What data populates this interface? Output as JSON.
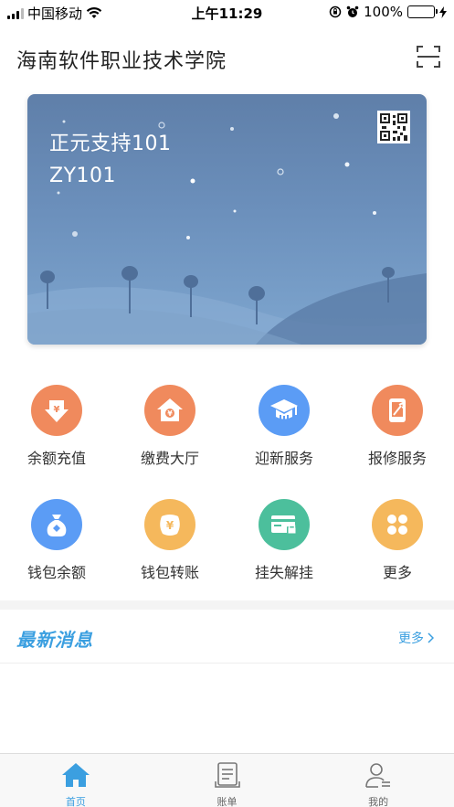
{
  "status_bar": {
    "carrier": "中国移动",
    "time": "上午11:29",
    "battery": "100%"
  },
  "header": {
    "title": "海南软件职业技术学院",
    "scan_icon": "scan-icon"
  },
  "card": {
    "name": "正元支持101",
    "id": "ZY101",
    "qr_icon": "qr-code-icon"
  },
  "services": [
    {
      "label": "余额充值",
      "icon": "recharge-icon",
      "color": "#f08a5d"
    },
    {
      "label": "缴费大厅",
      "icon": "payment-hall-icon",
      "color": "#f08a5d"
    },
    {
      "label": "迎新服务",
      "icon": "graduation-cap-icon",
      "color": "#5b9cf5"
    },
    {
      "label": "报修服务",
      "icon": "repair-icon",
      "color": "#f08a5d"
    },
    {
      "label": "钱包余额",
      "icon": "wallet-balance-icon",
      "color": "#5b9cf5"
    },
    {
      "label": "钱包转账",
      "icon": "wallet-transfer-icon",
      "color": "#f5b85c"
    },
    {
      "label": "挂失解挂",
      "icon": "card-lock-icon",
      "color": "#4cbf9c"
    },
    {
      "label": "更多",
      "icon": "more-icon",
      "color": "#f5b85c"
    }
  ],
  "news": {
    "title": "最新消息",
    "more": "更多"
  },
  "tabbar": {
    "tabs": [
      {
        "label": "首页",
        "icon": "home-icon",
        "active": true
      },
      {
        "label": "账单",
        "icon": "bill-icon",
        "active": false
      },
      {
        "label": "我的",
        "icon": "profile-icon",
        "active": false
      }
    ]
  },
  "colors": {
    "accent": "#3b9fe0",
    "orange": "#f08a5d",
    "blue": "#5b9cf5",
    "yellow": "#f5b85c",
    "green": "#4cbf9c"
  }
}
